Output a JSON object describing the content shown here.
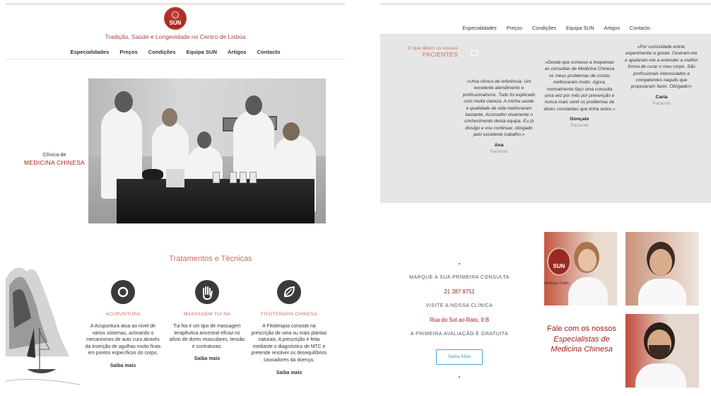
{
  "left": {
    "logo_text": "SUN",
    "tagline": "Tradição, Saúde e Longevidade no Centro de Lisboa",
    "nav": [
      "Especialidades",
      "Preços",
      "Condições",
      "Equipa SUN",
      "Artigos",
      "Contacto"
    ],
    "clinica_line1": "Clínica de",
    "clinica_line2": "MEDICINA CHINESA",
    "tratamentos_title": "Tratamentos e Técnicas",
    "treatments": [
      {
        "icon": "acupuncture-icon",
        "name": "ACUPUNTURA",
        "desc": "A Acupuntura atua ao nível de vários sistemas, activando o mecanismos de auto cura através da inserção de agulhas muito finas em pontos específicos do corpo.",
        "more": "Saiba mais"
      },
      {
        "icon": "hand-icon",
        "name": "MASSAGEM TUI NA",
        "desc": "Tui Na é um tipo de massagem terapêutica ancestral eficaz no alívio de dores musculares, tensão e contraturas.",
        "more": "Saiba mais"
      },
      {
        "icon": "leaf-icon",
        "name": "FITOTERAPIA CHINESA",
        "desc": "A Fitoterapia consiste na prescrição de uma ou mais plantas naturais. A prescrição é feita mediante o diagnóstico de MTC e pretende resolver os desequilíbrios causadores da doença.",
        "more": "Saiba mais"
      }
    ]
  },
  "right": {
    "nav": [
      "Especialidades",
      "Preços",
      "Condições",
      "Equipa SUN",
      "Artigos",
      "Contacto"
    ],
    "testimonials_label_1": "O que dizem os nossos",
    "testimonials_label_2": "PACIENTES",
    "testimonials": [
      {
        "quote": "«Uma clínica de referência. Um excelente atendimento e profissionalismo. Tudo foi explicado com muita clareza. A minha saúde e qualidade de vida melhoraram bastante. Aconselho vivamente o conhecimento desta equipa. Eu já divulgo e vou continuar, obrigado pelo excelente trabalho.»",
        "name": "Ana",
        "role": "Paciente"
      },
      {
        "quote": "«Desde que comecei a frequentar as consultas de Medicina Chinesa os meus problemas de costas melhoraram muito. Agora, normalmente faço uma consulta uma vez por mês por prevenção e nunca mais senti os problemas de dores constantes que tinha antes.»",
        "name": "Gonçalo",
        "role": "Paciente"
      },
      {
        "quote": "«Por curiosidade entrei, experimentei e gostei. Ouviram-me e ajudaram-me a entender a melhor forma de curar o meu corpo. São profissionais interessados e competentes naquilo que propuseram fazer. Obrigado!»",
        "name": "Carla",
        "role": "Paciente"
      }
    ],
    "cta": {
      "line1": "MARQUE A SUA PRIMEIRA CONSULTA",
      "phone": "21 387 8751",
      "line2": "VISITE A NOSSA CLÍNICA",
      "address": "Rua do Sol ao Rato, 9 B",
      "line3": "A PRIMEIRA AVALIAÇÃO É GRATUITA",
      "button": "Saiba Mais"
    },
    "fale_line1": "Fale com os nossos",
    "fale_line2": "Especialistas de",
    "fale_line3": "Medicina Chinesa",
    "sign_text": "SUN",
    "sign_caption": "Medicina Tradic"
  }
}
